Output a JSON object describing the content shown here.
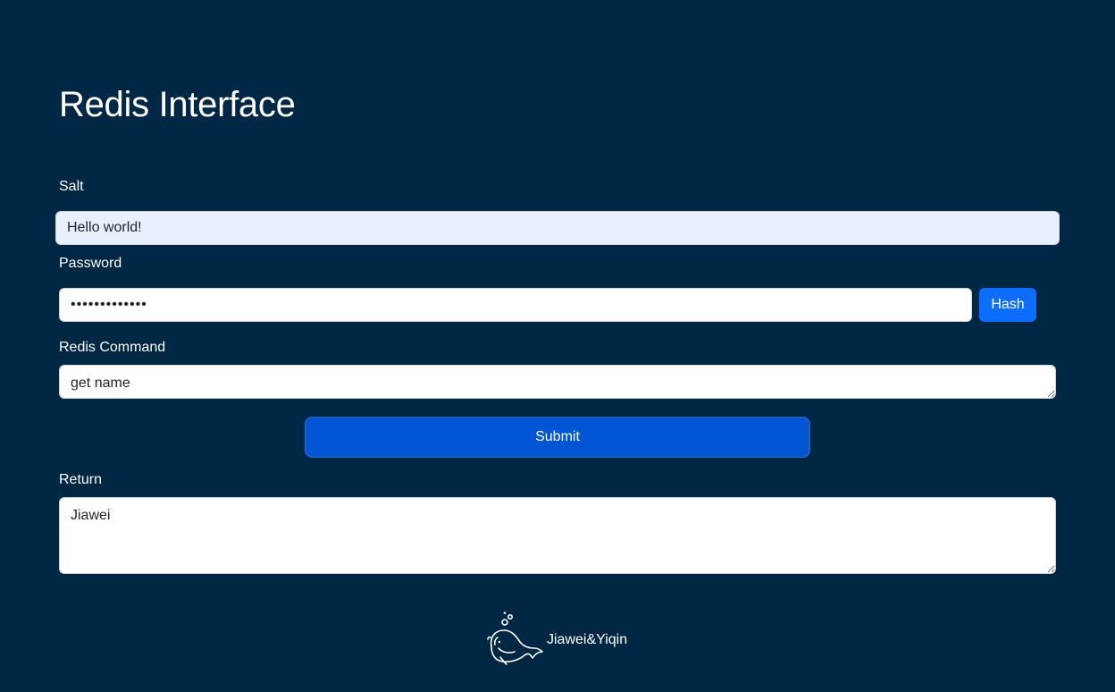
{
  "page": {
    "title": "Redis Interface"
  },
  "form": {
    "salt": {
      "label": "Salt",
      "value": "Hello world!"
    },
    "password": {
      "label": "Password",
      "value": "hello world!!"
    },
    "hash_button": "Hash",
    "command": {
      "label": "Redis Command",
      "value": "get name"
    },
    "submit_button": "Submit",
    "return": {
      "label": "Return",
      "value": "Jiawei"
    }
  },
  "footer": {
    "text": "Jiawei&Yiqin",
    "icon": "whale-icon"
  },
  "colors": {
    "background": "#002744",
    "primary": "#0d6efd",
    "submit": "#0055d4",
    "autofill": "#e8f0fe"
  }
}
